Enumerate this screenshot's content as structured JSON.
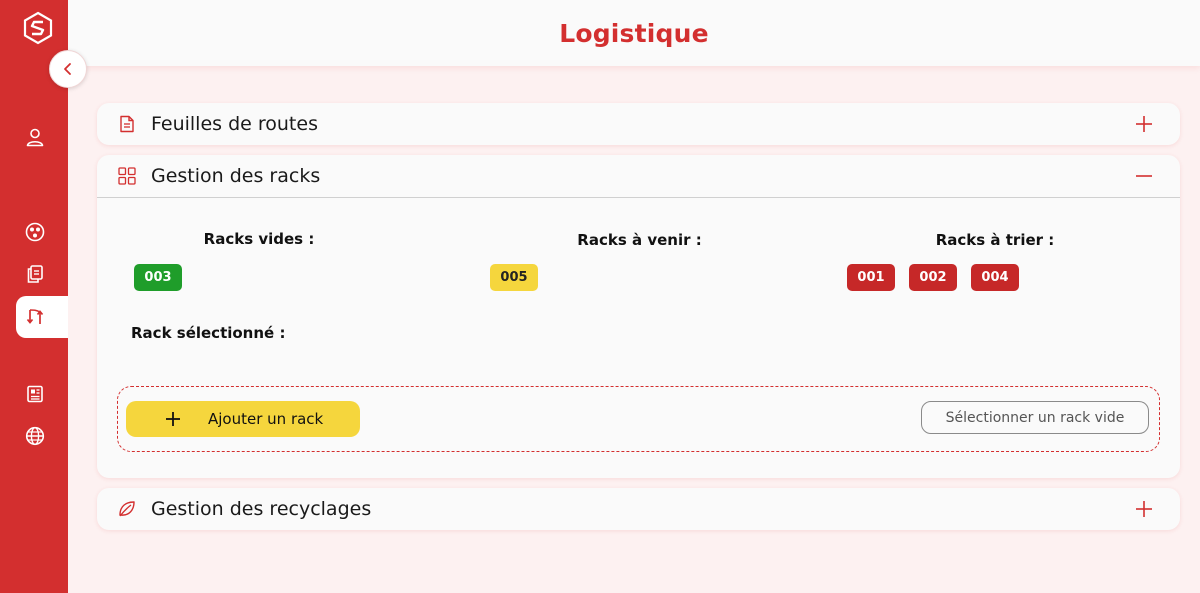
{
  "header": {
    "title": "Logistique"
  },
  "sidebar": {
    "items": [
      {
        "icon": "user-icon"
      },
      {
        "icon": "group-icon"
      },
      {
        "icon": "documents-icon"
      },
      {
        "icon": "transfer-icon",
        "active": true
      },
      {
        "icon": "newspaper-icon"
      },
      {
        "icon": "globe-icon"
      }
    ]
  },
  "panels": {
    "routes": {
      "title": "Feuilles de routes",
      "icon": "document-icon",
      "state": "collapsed"
    },
    "racks": {
      "title": "Gestion des racks",
      "icon": "grid-icon",
      "state": "expanded",
      "empty_label": "Racks vides :",
      "empty": [
        "003"
      ],
      "upcoming_label": "Racks à venir :",
      "upcoming": [
        "005"
      ],
      "to_sort_label": "Racks à trier :",
      "to_sort": [
        "001",
        "002",
        "004"
      ],
      "selected_label": "Rack sélectionné :",
      "add_button": "Ajouter un rack",
      "select_button": "Sélectionner un rack vide"
    },
    "recycling": {
      "title": "Gestion des recyclages",
      "icon": "leaf-icon",
      "state": "collapsed"
    }
  },
  "colors": {
    "brand": "#d32f2f",
    "green": "#1f9d2a",
    "yellow": "#f5d63d",
    "red": "#c62828"
  }
}
